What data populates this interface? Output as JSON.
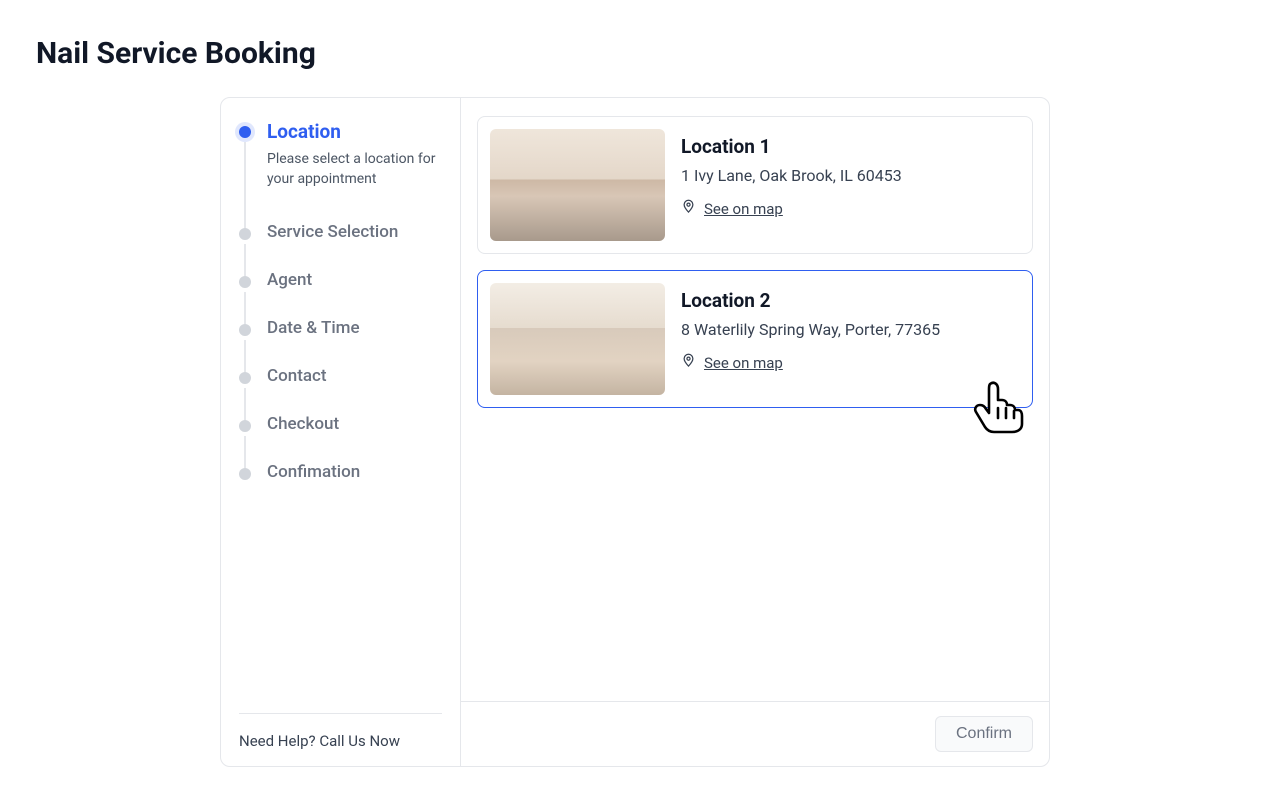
{
  "page_title": "Nail Service Booking",
  "sidebar": {
    "steps": [
      {
        "label": "Location",
        "description": "Please select a location for your appointment"
      },
      {
        "label": "Service Selection"
      },
      {
        "label": "Agent"
      },
      {
        "label": "Date & Time"
      },
      {
        "label": "Contact"
      },
      {
        "label": "Checkout"
      },
      {
        "label": "Confimation"
      }
    ],
    "active_index": 0,
    "help_text": "Need Help? Call Us Now"
  },
  "locations": [
    {
      "name": "Location 1",
      "address": "1 Ivy Lane, Oak Brook, IL 60453",
      "map_link_label": "See on map",
      "selected": false
    },
    {
      "name": "Location 2",
      "address": "8 Waterlily Spring Way, Porter, 77365",
      "map_link_label": "See on map",
      "selected": true
    }
  ],
  "footer": {
    "confirm_label": "Confirm"
  }
}
